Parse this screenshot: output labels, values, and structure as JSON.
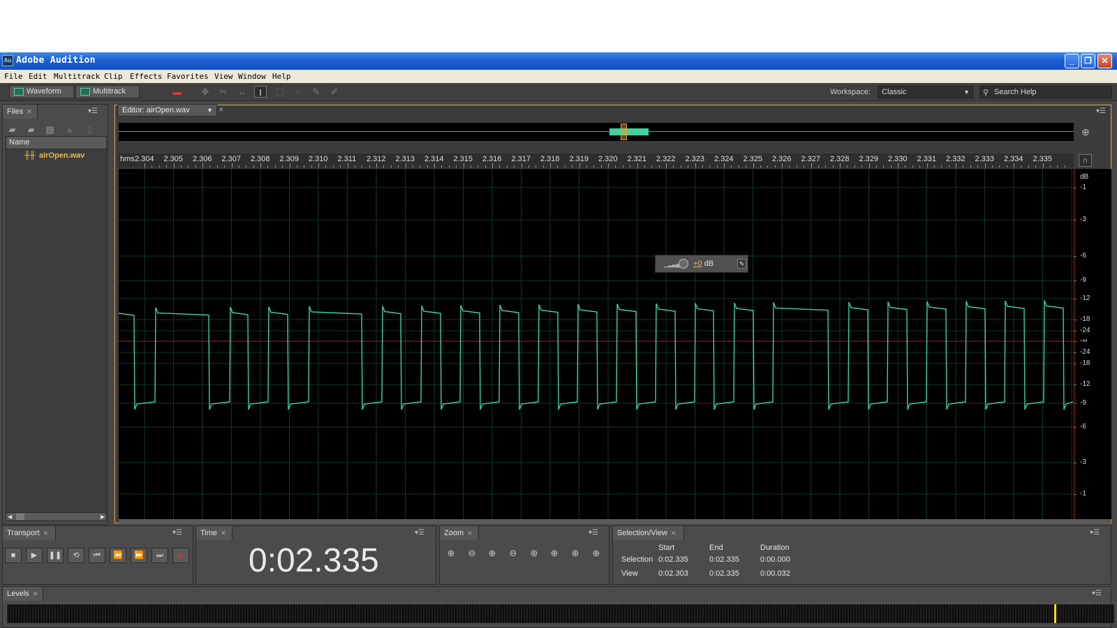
{
  "app": {
    "title": "Adobe Audition",
    "icon_text": "Au"
  },
  "window_controls": {
    "minimize": "_",
    "maximize": "❐",
    "close": "✕"
  },
  "menu": [
    "File",
    "Edit",
    "Multitrack",
    "Clip",
    "Effects",
    "Favorites",
    "View",
    "Window",
    "Help"
  ],
  "toolbar": {
    "waveform_label": "Waveform",
    "multitrack_label": "Multitrack",
    "workspace_label": "Workspace:",
    "workspace_value": "Classic",
    "search_placeholder": "Search Help"
  },
  "files_panel": {
    "tab_label": "Files",
    "column_name": "Name",
    "files": [
      "airOpen.wav"
    ]
  },
  "editor": {
    "tab_label": "Editor: airOpen.wav",
    "ruler_unit": "hms",
    "ruler_ticks": [
      "2.304",
      "2.305",
      "2.306",
      "2.307",
      "2.308",
      "2.309",
      "2.310",
      "2.311",
      "2.312",
      "2.313",
      "2.314",
      "2.315",
      "2.316",
      "2.317",
      "2.318",
      "2.319",
      "2.320",
      "2.321",
      "2.322",
      "2.323",
      "2.324",
      "2.325",
      "2.326",
      "2.327",
      "2.328",
      "2.329",
      "2.330",
      "2.331",
      "2.332",
      "2.333",
      "2.334",
      "2.335"
    ],
    "db_unit": "dB",
    "db_labels": [
      "-1",
      "-3",
      "-6",
      "-9",
      "-12",
      "-18",
      "-24",
      "-∞",
      "-24",
      "-18",
      "-12",
      "-9",
      "-6",
      "-3",
      "-1"
    ],
    "gain_value": "+0",
    "gain_unit": "dB",
    "colors": {
      "waveform": "#3fd3a0",
      "grid": "#0f3a26",
      "center_line": "#a02020",
      "accent": "#e9b84f"
    }
  },
  "transport": {
    "tab_label": "Transport",
    "buttons": [
      "stop",
      "play",
      "pause",
      "loop",
      "go-to-start",
      "rewind",
      "fast-forward",
      "go-to-end",
      "record"
    ]
  },
  "time_panel": {
    "tab_label": "Time",
    "display": "0:02.335"
  },
  "zoom_panel": {
    "tab_label": "Zoom"
  },
  "selection_panel": {
    "tab_label": "Selection/View",
    "headers": {
      "start": "Start",
      "end": "End",
      "duration": "Duration"
    },
    "selection": {
      "label": "Selection",
      "start": "0:02.335",
      "end": "0:02.335",
      "duration": "0:00.000"
    },
    "view": {
      "label": "View",
      "start": "0:02.303",
      "end": "0:02.335",
      "duration": "0:00.032"
    }
  },
  "levels_panel": {
    "tab_label": "Levels"
  }
}
